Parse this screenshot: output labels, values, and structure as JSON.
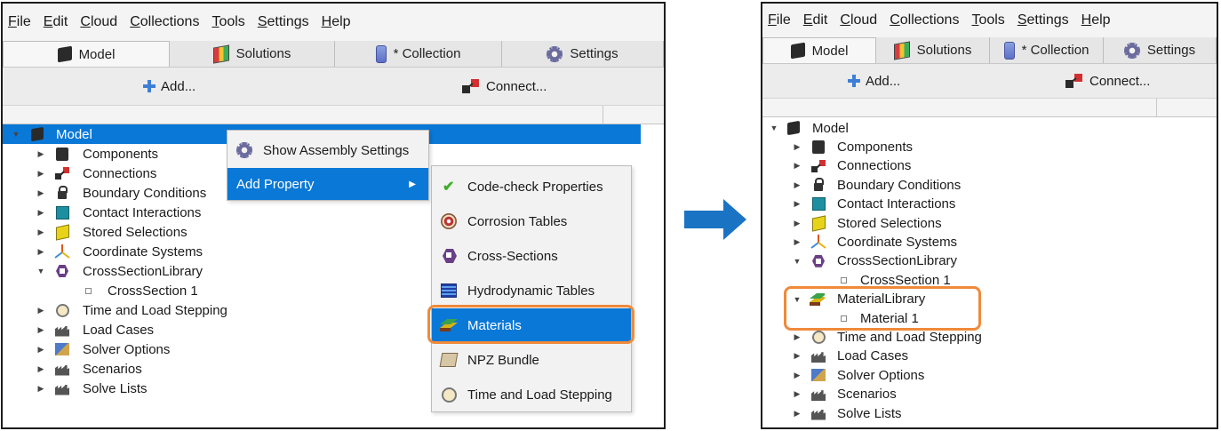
{
  "menus": [
    "File",
    "Edit",
    "Cloud",
    "Collections",
    "Tools",
    "Settings",
    "Help"
  ],
  "tabs": [
    {
      "label": "Model",
      "icon": "cube-icon"
    },
    {
      "label": "Solutions",
      "icon": "solutions-icon"
    },
    {
      "label": "* Collection",
      "icon": "collection-icon"
    },
    {
      "label": "Settings",
      "icon": "gear-icon"
    }
  ],
  "toolbar": {
    "add_label": "Add...",
    "connect_label": "Connect..."
  },
  "left_tree": {
    "root": "Model",
    "items": [
      {
        "label": "Components",
        "icon": "box-icon"
      },
      {
        "label": "Connections",
        "icon": "connection-icon"
      },
      {
        "label": "Boundary Conditions",
        "icon": "lock-icon"
      },
      {
        "label": "Contact Interactions",
        "icon": "contact-icon"
      },
      {
        "label": "Stored Selections",
        "icon": "stored-selection-icon"
      },
      {
        "label": "Coordinate Systems",
        "icon": "axes-icon"
      },
      {
        "label": "CrossSectionLibrary",
        "icon": "hexagon-icon"
      },
      {
        "label": "CrossSection 1",
        "icon": "leaf-icon"
      },
      {
        "label": "Time and Load Stepping",
        "icon": "clock-icon"
      },
      {
        "label": "Load Cases",
        "icon": "factory-icon"
      },
      {
        "label": "Solver Options",
        "icon": "solver-icon"
      },
      {
        "label": "Scenarios",
        "icon": "factory-icon"
      },
      {
        "label": "Solve Lists",
        "icon": "factory-icon"
      }
    ]
  },
  "context_menu": {
    "items": [
      "Show Assembly Settings",
      "Add Property"
    ]
  },
  "submenu": {
    "items": [
      "Code-check Properties",
      "Corrosion Tables",
      "Cross-Sections",
      "Hydrodynamic Tables",
      "Materials",
      "NPZ Bundle",
      "Time and Load Stepping"
    ]
  },
  "right_tree": {
    "root": "Model",
    "items": [
      {
        "label": "Components"
      },
      {
        "label": "Connections"
      },
      {
        "label": "Boundary Conditions"
      },
      {
        "label": "Contact Interactions"
      },
      {
        "label": "Stored Selections"
      },
      {
        "label": "Coordinate Systems"
      },
      {
        "label": "CrossSectionLibrary"
      },
      {
        "label": "CrossSection 1"
      },
      {
        "label": "MaterialLibrary"
      },
      {
        "label": "Material 1"
      },
      {
        "label": "Time and Load Stepping"
      },
      {
        "label": "Load Cases"
      },
      {
        "label": "Solver Options"
      },
      {
        "label": "Scenarios"
      },
      {
        "label": "Solve Lists"
      }
    ]
  },
  "colors": {
    "selection": "#0a78d7",
    "highlight": "#f08a3a",
    "arrow": "#1b73c4"
  }
}
